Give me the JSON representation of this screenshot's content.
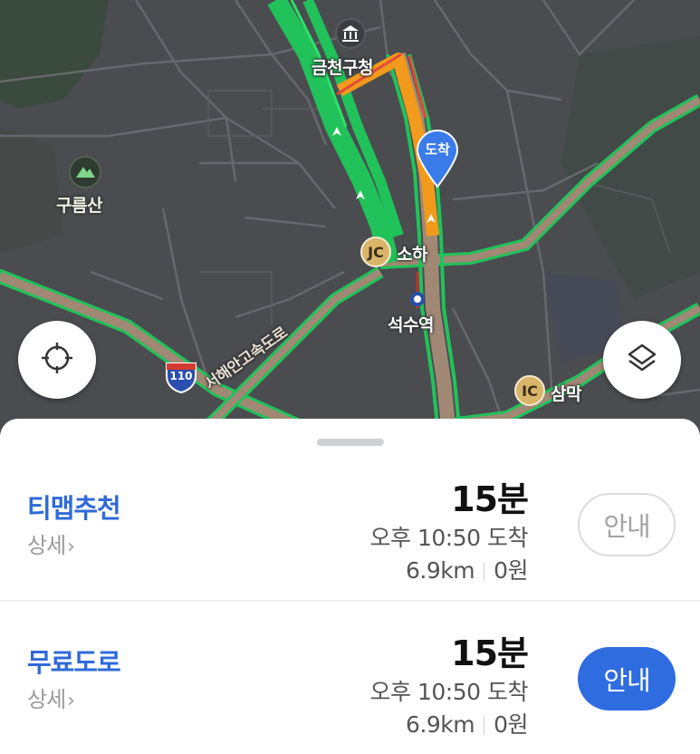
{
  "map": {
    "labels": {
      "district_office": "금천구청",
      "mountain": "구름산",
      "junction_soha": "소하",
      "station": "석수역",
      "ic_sammak": "삼막",
      "highway_name": "서해안고속도로"
    },
    "badges": {
      "jc": "JC",
      "ic": "IC"
    },
    "highway_shield": "110",
    "destination_pin": "도착",
    "icons": {
      "locate": "crosshair-icon",
      "layers": "layers-icon",
      "museum": "museum-icon",
      "mountain": "mountain-icon"
    },
    "colors": {
      "background": "#4a4c50",
      "road_major": "#a08874",
      "traffic_green": "#21c25a",
      "traffic_orange": "#f29a1c",
      "pin_blue": "#3a7bea"
    }
  },
  "routes": [
    {
      "name": "티맵추천",
      "detail": "상세",
      "duration": "15분",
      "arrival": "오후 10:50 도착",
      "distance": "6.9km",
      "toll": "0원",
      "button": "안내",
      "button_style": "outline"
    },
    {
      "name": "무료도로",
      "detail": "상세",
      "duration": "15분",
      "arrival": "오후 10:50 도착",
      "distance": "6.9km",
      "toll": "0원",
      "button": "안내",
      "button_style": "filled"
    }
  ],
  "colors": {
    "accent": "#2f6ad8",
    "button_active": "#2f6ce0"
  }
}
